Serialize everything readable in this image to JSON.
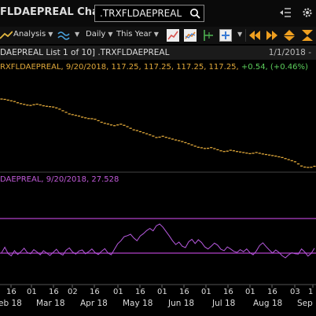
{
  "window": {
    "title": "FLDAEPREAL Chart"
  },
  "search": {
    "value": ".TRXFLDAEPREAL"
  },
  "toolbar": {
    "analysis_label": "Analysis",
    "interval_label": "Daily",
    "range_label": "This Year"
  },
  "header": {
    "list_label": "DAEPREAL List 1 of 10] .TRXFLDAEPREAL",
    "date_label": "1/1/2018 -"
  },
  "legend_price": {
    "text": "RXFLDAEPREAL, 9/20/2018, 117.25, 117.25, 117.25, 117.25,",
    "change": "+0.54, (+0.46%)"
  },
  "legend_ind": {
    "text": "DAEPREAL, 9/20/2018, 27.528"
  },
  "axis": {
    "months": [
      "eb 18",
      "Mar 18",
      "Apr 18",
      "May 18",
      "Jun 18",
      "Jul 18",
      "Aug 18",
      "Sep"
    ],
    "days": [
      "16",
      "01",
      "16",
      "02",
      "16",
      "01",
      "16",
      "01",
      "16",
      "01",
      "16",
      "01",
      "16",
      "03",
      "1"
    ]
  },
  "colors": {
    "price": "#e0a83a",
    "indicator": "#c05ad8",
    "change": "#5ccf5c"
  },
  "chart_data": {
    "type": "line",
    "series": [
      {
        "values": [
          155.2,
          155.0,
          154.6,
          154.2,
          153.8,
          153.1,
          152.6,
          152.2,
          151.8,
          151.6,
          152.0,
          152.3,
          151.9,
          151.4,
          151.1,
          150.9,
          150.7,
          150.2,
          149.5,
          148.6,
          147.7,
          146.8,
          146.4,
          146.0,
          145.6,
          145.0,
          144.6,
          144.2,
          144.1,
          143.8,
          143.0,
          142.1,
          141.5,
          141.1,
          140.6,
          140.2,
          140.6,
          141.0,
          140.4,
          139.6,
          138.7,
          137.8,
          137.4,
          136.8,
          136.2,
          135.6,
          135.0,
          134.3,
          133.5,
          133.7,
          134.2,
          133.6,
          133.1,
          132.6,
          132.1,
          131.7,
          131.2,
          130.6,
          130.0,
          129.3,
          128.6,
          128.0,
          127.7,
          127.3,
          127.4,
          127.8,
          127.2,
          126.6,
          126.0,
          125.6,
          125.8,
          126.3,
          126.0,
          125.6,
          125.3,
          125.0,
          124.7,
          124.4,
          124.6,
          125.0,
          124.6,
          124.2,
          123.9,
          123.6,
          123.3,
          123.0,
          122.6,
          122.2,
          121.6,
          121.0,
          120.4,
          119.8,
          118.6,
          117.4,
          116.8,
          116.6,
          116.7,
          117.25
        ]
      },
      {
        "values": [
          26.2,
          27.8,
          26.0,
          25.3,
          26.8,
          25.7,
          26.5,
          27.5,
          26.2,
          25.9,
          27.1,
          26.4,
          25.6,
          26.8,
          26.1,
          25.4,
          26.3,
          27.2,
          26.0,
          25.5,
          26.9,
          27.6,
          26.4,
          25.8,
          26.7,
          27.0,
          25.9,
          26.5,
          27.3,
          26.2,
          25.7,
          26.6,
          27.4,
          26.1,
          25.6,
          27.2,
          28.8,
          29.7,
          30.9,
          31.2,
          31.6,
          30.5,
          29.7,
          31.1,
          31.8,
          32.7,
          33.3,
          32.6,
          34.1,
          34.6,
          33.7,
          32.4,
          31.1,
          29.7,
          28.6,
          29.3,
          28.1,
          27.7,
          29.4,
          30.1,
          28.9,
          30.0,
          29.2,
          27.9,
          27.3,
          28.1,
          29.0,
          28.4,
          27.2,
          26.8,
          27.9,
          27.3,
          26.6,
          26.3,
          27.1,
          26.5,
          27.3,
          26.2,
          25.6,
          26.7,
          28.3,
          29.1,
          28.0,
          27.0,
          26.1,
          27.0,
          26.3,
          25.3,
          24.7,
          25.6,
          26.2,
          25.9,
          25.8,
          27.3,
          26.4,
          25.2,
          26.0,
          27.528
        ]
      }
    ]
  }
}
